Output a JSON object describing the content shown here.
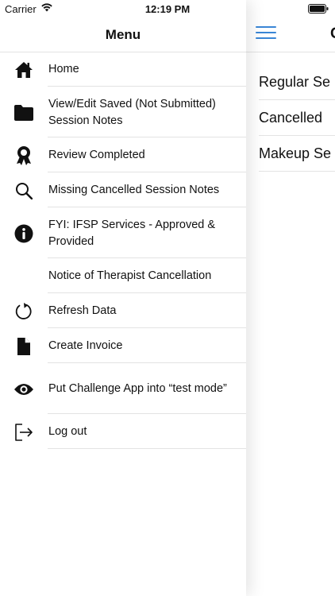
{
  "status_bar": {
    "carrier": "Carrier",
    "time": "12:19 PM"
  },
  "menu": {
    "title": "Menu",
    "items": [
      {
        "label": "Home",
        "icon": "home-icon"
      },
      {
        "label": "View/Edit Saved (Not Submitted) Session Notes",
        "icon": "folder-icon"
      },
      {
        "label": "Review Completed",
        "icon": "award-icon"
      },
      {
        "label": "Missing Cancelled Session Notes",
        "icon": "search-icon"
      },
      {
        "label": "FYI: IFSP Services - Approved & Provided",
        "icon": "info-icon"
      },
      {
        "label": "Notice of Therapist Cancellation",
        "icon": ""
      },
      {
        "label": "Refresh Data",
        "icon": "refresh-icon"
      },
      {
        "label": "Create Invoice",
        "icon": "document-icon"
      },
      {
        "label": "Put Challenge App into “test mode”",
        "icon": "eye-icon"
      },
      {
        "label": "Log out",
        "icon": "logout-icon"
      }
    ]
  },
  "background_screen": {
    "title": "C",
    "items": [
      "Regular Se",
      "Cancelled",
      "Makeup Se"
    ]
  },
  "colors": {
    "accent": "#3a86d6",
    "divider": "#e3e3e3",
    "text": "#111111"
  }
}
